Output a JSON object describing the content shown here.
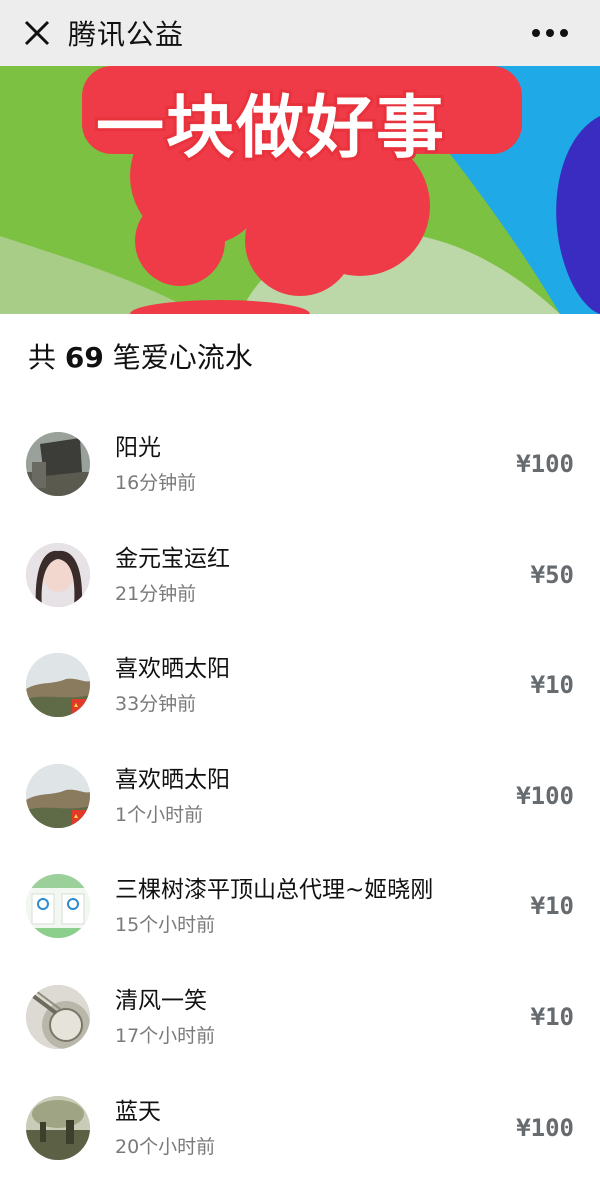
{
  "header": {
    "title": "腾讯公益",
    "close_icon": "close-icon",
    "more_icon": "more-icon"
  },
  "banner": {
    "text": "一块做好事",
    "colors": {
      "green": "#7cc142",
      "red": "#ef3b47",
      "blue": "#1fa9e6",
      "purple": "#3a2cc0"
    }
  },
  "summary": {
    "prefix": "共",
    "count": "69",
    "suffix": "笔爱心流水"
  },
  "donations": [
    {
      "name": "阳光",
      "time": "16分钟前",
      "amount": "¥100"
    },
    {
      "name": "金元宝运红",
      "time": "21分钟前",
      "amount": "¥50"
    },
    {
      "name": "喜欢晒太阳",
      "time": "33分钟前",
      "amount": "¥10"
    },
    {
      "name": "喜欢晒太阳",
      "time": "1个小时前",
      "amount": "¥100"
    },
    {
      "name": "三棵树漆平顶山总代理~姬晓刚",
      "time": "15个小时前",
      "amount": "¥10"
    },
    {
      "name": "清风一笑",
      "time": "17个小时前",
      "amount": "¥10"
    },
    {
      "name": "蓝天",
      "time": "20个小时前",
      "amount": "¥100"
    }
  ]
}
